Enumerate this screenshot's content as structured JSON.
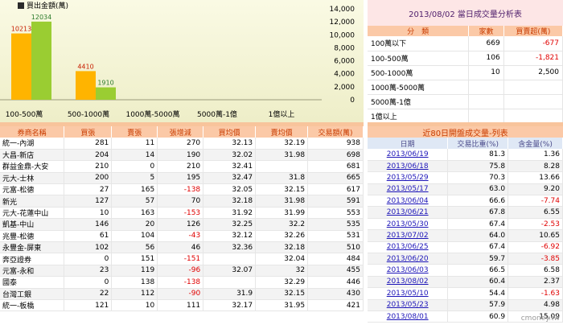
{
  "chart_data": {
    "type": "bar",
    "title": "",
    "legend": "買出金額(萬)",
    "categories": [
      "100-500萬",
      "500-1000萬",
      "1000萬-5000萬",
      "5000萬-1億",
      "1億以上"
    ],
    "series": [
      {
        "name": "",
        "color": "#ffb400",
        "values": [
          10213,
          4410,
          0,
          0,
          0
        ]
      },
      {
        "name": "",
        "color": "#9acd32",
        "values": [
          12034,
          1910,
          0,
          0,
          0
        ]
      }
    ],
    "ylim": [
      0,
      14000
    ],
    "yticks": [
      0,
      2000,
      4000,
      6000,
      8000,
      10000,
      12000,
      14000
    ],
    "tick_labels": [
      "0",
      "2,000",
      "4,000",
      "6,000",
      "8,000",
      "10,000",
      "12,000",
      "14,000"
    ],
    "value_labels": [
      [
        "10213",
        "12034"
      ],
      [
        "4410",
        "1910"
      ],
      [
        "",
        ""
      ],
      [
        "",
        ""
      ],
      [
        "",
        ""
      ]
    ]
  },
  "summary": {
    "title": "2013/08/02  當日成交量分析表",
    "headers": [
      "分　類",
      "家數",
      "買賣超(萬)"
    ],
    "rows": [
      {
        "label": "100萬以下",
        "count": "669",
        "net": "-677",
        "neg": true
      },
      {
        "label": "100-500萬",
        "count": "106",
        "net": "-1,821",
        "neg": true
      },
      {
        "label": "500-1000萬",
        "count": "10",
        "net": "2,500",
        "neg": false
      },
      {
        "label": "1000萬-5000萬",
        "count": "",
        "net": "",
        "neg": false
      },
      {
        "label": "5000萬-1億",
        "count": "",
        "net": "",
        "neg": false
      },
      {
        "label": "1億以上",
        "count": "",
        "net": "",
        "neg": false
      }
    ]
  },
  "brokers": {
    "headers": [
      "券商名稱",
      "買張",
      "賣張",
      "張增減",
      "買均價",
      "賣均價",
      "交易額(萬)"
    ],
    "rows": [
      {
        "name": "統一-內湖",
        "buy": "281",
        "sell": "11",
        "diff": "270",
        "buyavg": "32.13",
        "sellavg": "32.19",
        "amount": "938",
        "neg": false
      },
      {
        "name": "大昌-新店",
        "buy": "204",
        "sell": "14",
        "diff": "190",
        "buyavg": "32.02",
        "sellavg": "31.98",
        "amount": "698",
        "neg": false
      },
      {
        "name": "群益金鼎-大安",
        "buy": "210",
        "sell": "0",
        "diff": "210",
        "buyavg": "32.41",
        "sellavg": "",
        "amount": "681",
        "neg": false
      },
      {
        "name": "元大-士林",
        "buy": "200",
        "sell": "5",
        "diff": "195",
        "buyavg": "32.47",
        "sellavg": "31.8",
        "amount": "665",
        "neg": false
      },
      {
        "name": "元富-松德",
        "buy": "27",
        "sell": "165",
        "diff": "-138",
        "buyavg": "32.05",
        "sellavg": "32.15",
        "amount": "617",
        "neg": true
      },
      {
        "name": "新光",
        "buy": "127",
        "sell": "57",
        "diff": "70",
        "buyavg": "32.18",
        "sellavg": "31.98",
        "amount": "591",
        "neg": false
      },
      {
        "name": "元大-花蓮中山",
        "buy": "10",
        "sell": "163",
        "diff": "-153",
        "buyavg": "31.92",
        "sellavg": "31.99",
        "amount": "553",
        "neg": true
      },
      {
        "name": "凱基-中山",
        "buy": "146",
        "sell": "20",
        "diff": "126",
        "buyavg": "32.25",
        "sellavg": "32.2",
        "amount": "535",
        "neg": false
      },
      {
        "name": "兆豐-松德",
        "buy": "61",
        "sell": "104",
        "diff": "-43",
        "buyavg": "32.12",
        "sellavg": "32.26",
        "amount": "531",
        "neg": true
      },
      {
        "name": "永豐金-屏東",
        "buy": "102",
        "sell": "56",
        "diff": "46",
        "buyavg": "32.36",
        "sellavg": "32.18",
        "amount": "510",
        "neg": false
      },
      {
        "name": "奔亞證券",
        "buy": "0",
        "sell": "151",
        "diff": "-151",
        "buyavg": "",
        "sellavg": "32.04",
        "amount": "484",
        "neg": true
      },
      {
        "name": "元富-永和",
        "buy": "23",
        "sell": "119",
        "diff": "-96",
        "buyavg": "32.07",
        "sellavg": "32",
        "amount": "455",
        "neg": true
      },
      {
        "name": "國泰",
        "buy": "0",
        "sell": "138",
        "diff": "-138",
        "buyavg": "",
        "sellavg": "32.29",
        "amount": "446",
        "neg": true
      },
      {
        "name": "台灣工銀",
        "buy": "22",
        "sell": "112",
        "diff": "-90",
        "buyavg": "31.9",
        "sellavg": "32.15",
        "amount": "430",
        "neg": true
      },
      {
        "name": "統一-板橋",
        "buy": "121",
        "sell": "10",
        "diff": "111",
        "buyavg": "32.17",
        "sellavg": "31.95",
        "amount": "421",
        "neg": false
      }
    ]
  },
  "days": {
    "title": "近80日開盤成交量-列表",
    "headers": [
      "日期",
      "交易比重(%)",
      "含金量(%)"
    ],
    "rows": [
      {
        "date": "2013/06/19",
        "ratio": "81.3",
        "gold": "1.36",
        "neg": false
      },
      {
        "date": "2013/06/18",
        "ratio": "75.8",
        "gold": "8.28",
        "neg": false
      },
      {
        "date": "2013/05/29",
        "ratio": "70.3",
        "gold": "13.66",
        "neg": false
      },
      {
        "date": "2013/05/17",
        "ratio": "63.0",
        "gold": "9.20",
        "neg": false
      },
      {
        "date": "2013/06/04",
        "ratio": "66.6",
        "gold": "-7.74",
        "neg": true
      },
      {
        "date": "2013/06/21",
        "ratio": "67.8",
        "gold": "6.55",
        "neg": false
      },
      {
        "date": "2013/05/30",
        "ratio": "67.4",
        "gold": "-2.53",
        "neg": true
      },
      {
        "date": "2013/07/02",
        "ratio": "64.0",
        "gold": "10.65",
        "neg": false
      },
      {
        "date": "2013/06/25",
        "ratio": "67.4",
        "gold": "-6.92",
        "neg": true
      },
      {
        "date": "2013/06/20",
        "ratio": "59.7",
        "gold": "-3.85",
        "neg": true
      },
      {
        "date": "2013/06/03",
        "ratio": "66.5",
        "gold": "6.58",
        "neg": false
      },
      {
        "date": "2013/08/02",
        "ratio": "60.4",
        "gold": "2.37",
        "neg": false
      },
      {
        "date": "2013/05/10",
        "ratio": "54.4",
        "gold": "-1.63",
        "neg": true
      },
      {
        "date": "2013/05/23",
        "ratio": "57.9",
        "gold": "4.98",
        "neg": false
      },
      {
        "date": "2013/08/01",
        "ratio": "60.9",
        "gold": "15.09",
        "neg": false
      }
    ]
  },
  "watermark": "cmoney.tw",
  "colors": {
    "accent_header": "#fbc9a7",
    "negative": "#e00000",
    "link": "#1c14b8"
  }
}
